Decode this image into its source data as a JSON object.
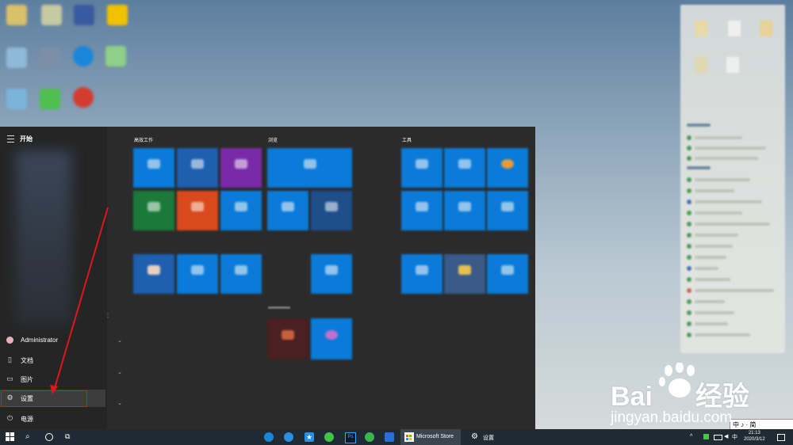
{
  "start_menu": {
    "title": "开始",
    "groups": [
      "高效工作",
      "浏览",
      "工具"
    ],
    "user": "Administrator",
    "items": {
      "documents": "文档",
      "pictures": "图片",
      "settings": "设置",
      "power": "电源"
    }
  },
  "taskbar": {
    "store_label": "Microsoft Store",
    "settings_label": "设置",
    "clock_time": "21:13",
    "clock_date": "2020/3/12"
  },
  "ime": {
    "text": "中 ♪ · 简"
  },
  "watermark": {
    "brand": "Bai",
    "brand_cn": "经验",
    "url": "jingyan.baidu.com"
  },
  "colors": {
    "tile_blue": "#0a7bd8",
    "tile_darkblue": "#1e5fb0",
    "tile_purple": "#7a2aa8",
    "tile_green": "#1b7a3a",
    "tile_orange": "#d84a1b",
    "highlight_red": "#e0161d"
  }
}
